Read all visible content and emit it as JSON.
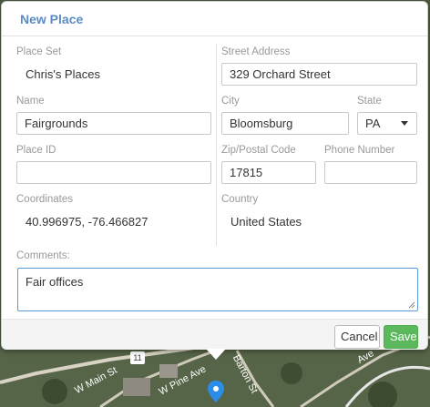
{
  "dialog": {
    "title": "New Place"
  },
  "form": {
    "place_set": {
      "label": "Place Set",
      "value": "Chris's Places"
    },
    "name": {
      "label": "Name",
      "value": "Fairgrounds"
    },
    "place_id": {
      "label": "Place ID",
      "value": ""
    },
    "coordinates": {
      "label": "Coordinates",
      "value": "40.996975, -76.466827"
    },
    "street_address": {
      "label": "Street Address",
      "value": "329 Orchard Street"
    },
    "city": {
      "label": "City",
      "value": "Bloomsburg"
    },
    "state": {
      "label": "State",
      "value": "PA"
    },
    "postal_code": {
      "label": "Zip/Postal Code",
      "value": "17815"
    },
    "phone": {
      "label": "Phone Number",
      "value": ""
    },
    "country": {
      "label": "Country",
      "value": "United States"
    },
    "comments": {
      "label": "Comments:",
      "value": "Fair offices"
    }
  },
  "buttons": {
    "cancel": "Cancel",
    "save": "Save"
  },
  "map": {
    "streets": [
      "W Main St",
      "W Pine Ave",
      "Barton St",
      "Ave"
    ],
    "route_shield": "11",
    "pin_color": "#2b8de8"
  }
}
